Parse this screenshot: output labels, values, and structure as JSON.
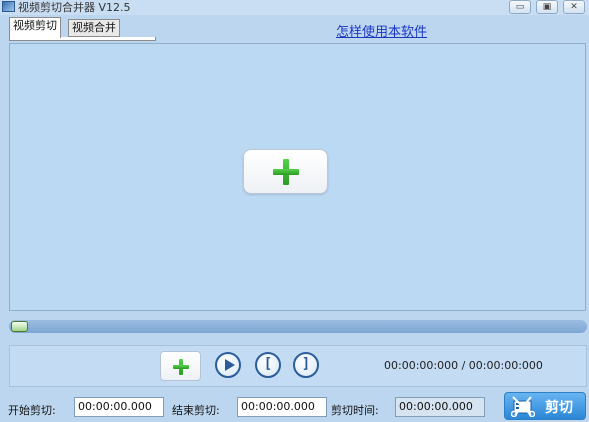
{
  "window": {
    "title": "视频剪切合并器 V12.5",
    "icon": "app-film-icon",
    "controls": {
      "minimize": "▭",
      "maximize": "▣",
      "close": "✕"
    }
  },
  "tabs": [
    {
      "label": "视频剪切",
      "active": true
    },
    {
      "label": "视频合并",
      "active": false
    }
  ],
  "help_link": "怎样使用本软件",
  "video_area": {
    "add_button_icon": "plus-icon"
  },
  "progress": {
    "value_percent": 0
  },
  "playback": {
    "add_icon": "plus-icon",
    "play_icon": "play-icon",
    "set_start_icon": "bracket-left-icon",
    "set_start_glyph": "[",
    "set_end_icon": "bracket-right-icon",
    "set_end_glyph": "]",
    "time_display": "00:00:00:000 / 00:00:00:000"
  },
  "bottom": {
    "start_label": "开始剪切:",
    "start_value": "00:00:00.000",
    "end_label": "结束剪切:",
    "end_value": "00:00:00.000",
    "duration_label": "剪切时间:",
    "duration_value": "00:00:00.000",
    "cut_button": "剪切",
    "cut_icon": "scissors-icon"
  },
  "colors": {
    "accent": "#2a86d6",
    "plus_green": "#3cb832",
    "link": "#1a37c4",
    "window_bg": "#bcd6ef"
  }
}
